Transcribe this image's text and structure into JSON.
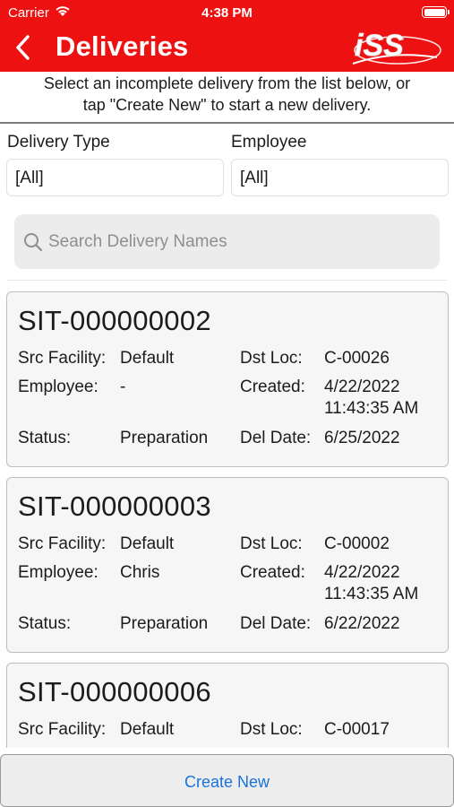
{
  "status_bar": {
    "carrier": "Carrier",
    "time": "4:38 PM"
  },
  "header": {
    "title": "Deliveries",
    "logo_text": "iSS",
    "accent_color": "#ee1111"
  },
  "intro": {
    "line1": "Select an incomplete delivery from the list below, or",
    "line2": "tap \"Create New\" to start a new delivery."
  },
  "filters": {
    "delivery_type": {
      "label": "Delivery Type",
      "value": "[All]"
    },
    "employee": {
      "label": "Employee",
      "value": "[All]"
    }
  },
  "search": {
    "placeholder": "Search Delivery Names"
  },
  "labels": {
    "src_facility": "Src Facility:",
    "dst_loc": "Dst Loc:",
    "employee": "Employee:",
    "created": "Created:",
    "status": "Status:",
    "del_date": "Del Date:"
  },
  "deliveries": [
    {
      "id": "SIT-000000002",
      "src_facility": "Default",
      "dst_loc": "C-00026",
      "employee": "-",
      "created_date": "4/22/2022",
      "created_time": "11:43:35 AM",
      "status": "Preparation",
      "del_date": "6/25/2022"
    },
    {
      "id": "SIT-000000003",
      "src_facility": "Default",
      "dst_loc": "C-00002",
      "employee": "Chris",
      "created_date": "4/22/2022",
      "created_time": "11:43:35 AM",
      "status": "Preparation",
      "del_date": "6/22/2022"
    },
    {
      "id": "SIT-000000006",
      "src_facility": "Default",
      "dst_loc": "C-00017"
    }
  ],
  "create_button": {
    "label": "Create New"
  }
}
